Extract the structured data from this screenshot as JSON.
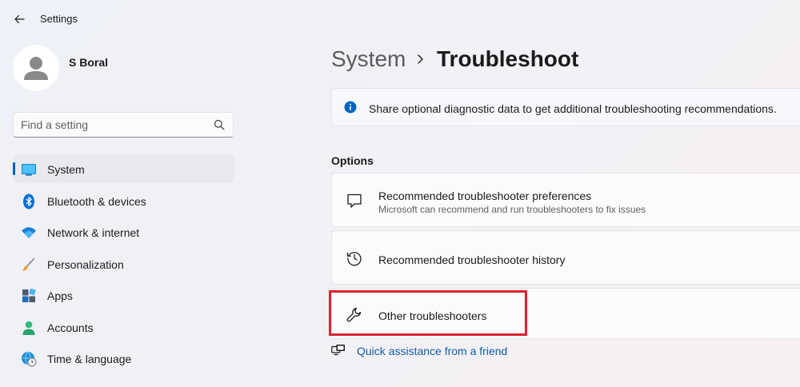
{
  "app": {
    "title": "Settings"
  },
  "profile": {
    "name": "S Boral"
  },
  "search": {
    "placeholder": "Find a setting"
  },
  "sidebar": {
    "items": [
      {
        "label": "System",
        "icon": "system-display-icon",
        "selected": true
      },
      {
        "label": "Bluetooth & devices",
        "icon": "bluetooth-icon"
      },
      {
        "label": "Network & internet",
        "icon": "wifi-icon"
      },
      {
        "label": "Personalization",
        "icon": "brush-icon"
      },
      {
        "label": "Apps",
        "icon": "apps-icon"
      },
      {
        "label": "Accounts",
        "icon": "accounts-icon"
      },
      {
        "label": "Time & language",
        "icon": "globe-clock-icon"
      }
    ]
  },
  "breadcrumb": {
    "parent": "System",
    "current": "Troubleshoot"
  },
  "infobar": {
    "text": "Share optional diagnostic data to get additional troubleshooting recommendations."
  },
  "options": {
    "title": "Options",
    "items": [
      {
        "title": "Recommended troubleshooter preferences",
        "subtitle": "Microsoft can recommend and run troubleshooters to fix issues",
        "icon": "chat-bubble-icon"
      },
      {
        "title": "Recommended troubleshooter history",
        "icon": "history-icon"
      },
      {
        "title": "Other troubleshooters",
        "icon": "wrench-icon"
      }
    ]
  },
  "quick_link": {
    "label": "Quick assistance from a friend",
    "icon": "remote-assist-icon"
  },
  "colors": {
    "accent": "#005fb8",
    "link": "#0f5ea8",
    "highlight": "#d9232e"
  }
}
